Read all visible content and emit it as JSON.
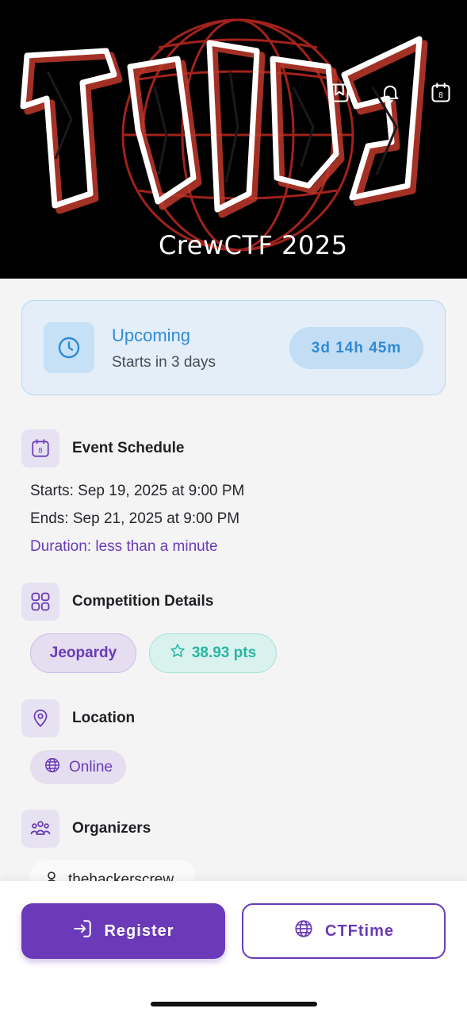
{
  "hero": {
    "title": "CrewCTF 2025",
    "actions": [
      {
        "name": "bookmark-icon"
      },
      {
        "name": "bell-icon"
      },
      {
        "name": "calendar-icon",
        "badge": "8"
      }
    ]
  },
  "status": {
    "title": "Upcoming",
    "subtitle": "Starts in 3 days",
    "countdown": "3d 14h 45m",
    "icon": "clock-icon"
  },
  "schedule": {
    "title": "Event Schedule",
    "icon_badge": "8",
    "starts": "Starts: Sep 19, 2025 at 9:00 PM",
    "ends": "Ends: Sep 21, 2025 at 9:00 PM",
    "duration": "Duration: less than a minute"
  },
  "competition": {
    "title": "Competition Details",
    "format": "Jeopardy",
    "points": "38.93 pts"
  },
  "location": {
    "title": "Location",
    "value": "Online"
  },
  "organizers": {
    "title": "Organizers",
    "items": [
      "thehackerscrew"
    ]
  },
  "actions": {
    "register_label": "Register",
    "ctftime_label": "CTFtime"
  },
  "colors": {
    "accent": "#6a3ab8",
    "status_blue": "#2f8ad6",
    "points_teal": "#25b7a1",
    "background": "#f4f4f5"
  }
}
